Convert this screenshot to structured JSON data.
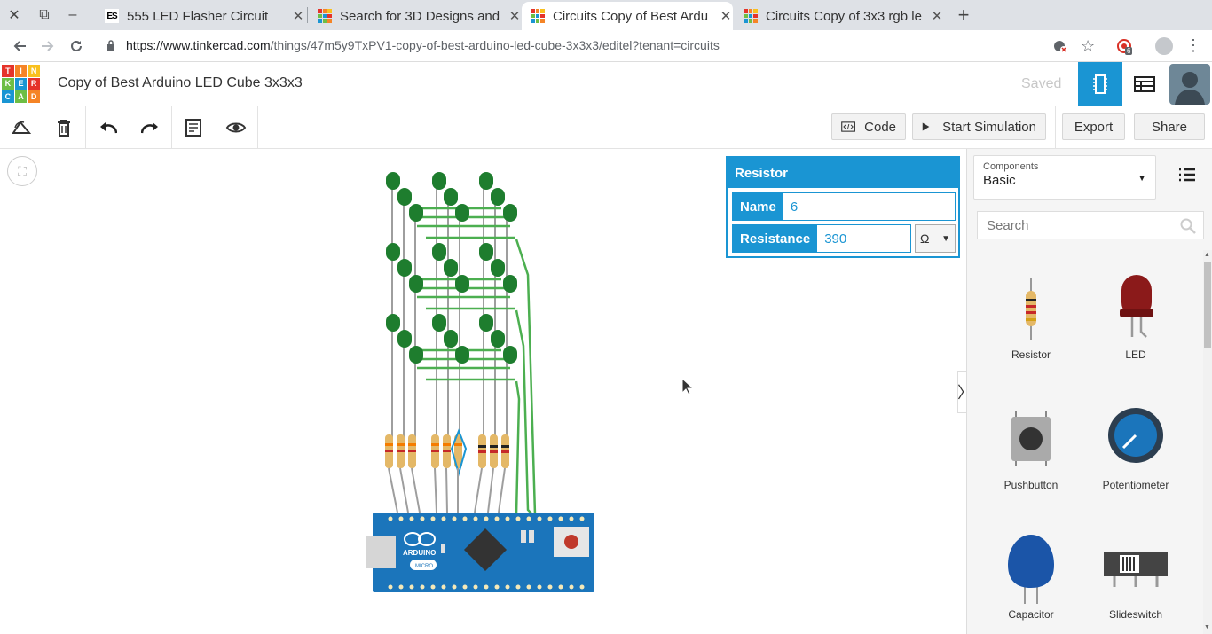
{
  "browser": {
    "tabs": [
      {
        "title": "555 LED Flasher Circuit",
        "active": false,
        "favicon": "es-icon"
      },
      {
        "title": "Search for 3D Designs and",
        "active": false,
        "favicon": "tinkercad-icon"
      },
      {
        "title": "Circuits Copy of Best Ardu",
        "active": true,
        "favicon": "tinkercad-icon"
      },
      {
        "title": "Circuits Copy of 3x3 rgb le",
        "active": false,
        "favicon": "tinkercad-icon"
      }
    ],
    "url_domain": "https://www.tinkercad.com",
    "url_path": "/things/47m5y9TxPV1-copy-of-best-arduino-led-cube-3x3x3/editel?tenant=circuits",
    "ext_badge": "6"
  },
  "app": {
    "logo_letters": [
      "T",
      "I",
      "N",
      "K",
      "E",
      "R",
      "C",
      "A",
      "D"
    ],
    "logo_colors": [
      "#e5332a",
      "#f58426",
      "#f9c01e",
      "#6ebe44",
      "#1a95d3",
      "#e5332a",
      "#1a95d3",
      "#6ebe44",
      "#f58426"
    ],
    "title": "Copy of Best Arduino LED Cube 3x3x3",
    "save_status": "Saved",
    "accent": "#1a95d3"
  },
  "toolbar": {
    "code_label": "Code",
    "start_sim_label": "Start Simulation",
    "export_label": "Export",
    "share_label": "Share"
  },
  "inspector": {
    "title": "Resistor",
    "name_label": "Name",
    "name_value": "6",
    "resistance_label": "Resistance",
    "resistance_value": "390",
    "unit": "Ω"
  },
  "panel": {
    "category_label": "Components",
    "category_value": "Basic",
    "search_placeholder": "Search",
    "components": [
      {
        "name": "Resistor",
        "icon": "resistor-icon"
      },
      {
        "name": "LED",
        "icon": "led-icon"
      },
      {
        "name": "Pushbutton",
        "icon": "pushbutton-icon"
      },
      {
        "name": "Potentiometer",
        "icon": "potentiometer-icon"
      },
      {
        "name": "Capacitor",
        "icon": "capacitor-icon"
      },
      {
        "name": "Slideswitch",
        "icon": "slideswitch-icon"
      }
    ]
  },
  "board": {
    "brand": "ARDUINO",
    "model": "MICRO"
  }
}
